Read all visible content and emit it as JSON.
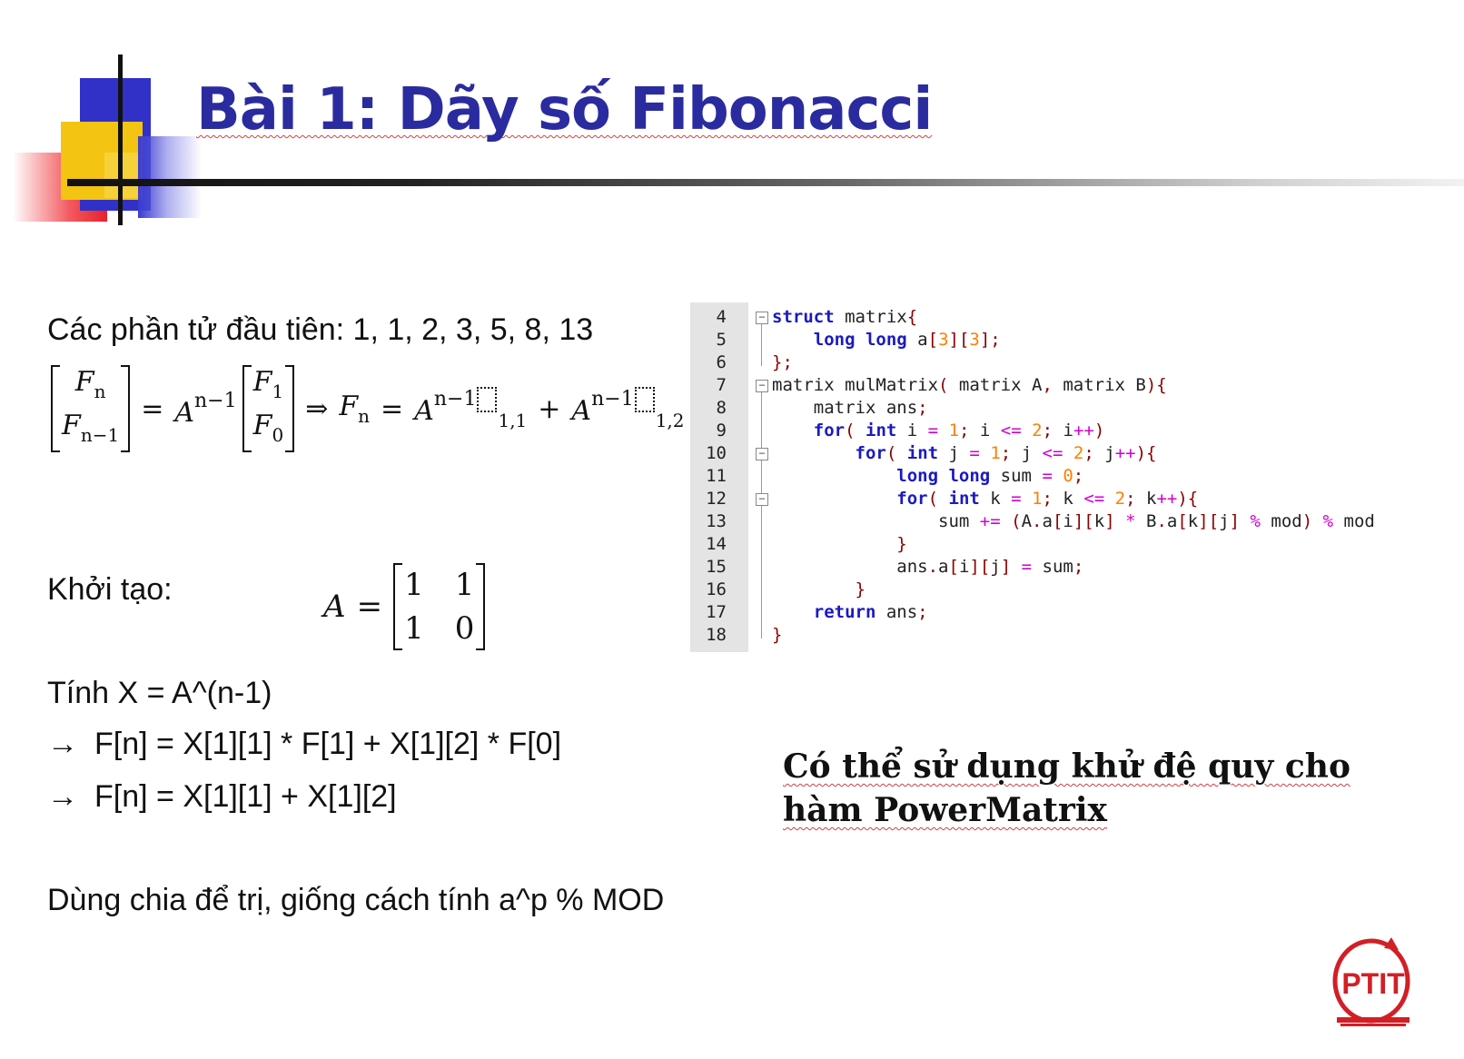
{
  "slide": {
    "title": "Bài 1: Dãy số Fibonacci",
    "elements_line": "Các phần tử đầu tiên: 1, 1, 2, 3, 5, 8, 13",
    "formula": {
      "lhs_top": "F",
      "lhs_top_sub": "n",
      "lhs_bottom": "F",
      "lhs_bottom_sub": "n−1",
      "eq": "=",
      "A": "A",
      "power": "n−1",
      "rhs_top": "F",
      "rhs_top_sub": "1",
      "rhs_bottom": "F",
      "rhs_bottom_sub": "0",
      "implies": "⇒",
      "Fn": "F",
      "Fn_sub": "n",
      "idx1": "1,1",
      "plus": "+",
      "idx2": "1,2"
    },
    "init_label": "Khởi tạo:",
    "matrix_A": {
      "name": "A",
      "eq": "=",
      "rows": [
        [
          "1",
          "1"
        ],
        [
          "1",
          "0"
        ]
      ]
    },
    "compute_line": "Tính X = A^(n-1)",
    "arrow_lines": [
      "F[n] = X[1][1] * F[1] + X[1][2] * F[0]",
      "F[n] = X[1][1] + X[1][2]"
    ],
    "arrow_icon": "right-arrow-icon",
    "dnc_line": "Dùng chia để trị, giống cách tính a^p % MOD",
    "note": "Có thể sử dụng khử đệ quy cho hàm PowerMatrix",
    "logo_text": "PTIT"
  },
  "code": {
    "line_numbers": [
      "4",
      "5",
      "6",
      "7",
      "8",
      "9",
      "10",
      "11",
      "12",
      "13",
      "14",
      "15",
      "16",
      "17",
      "18"
    ],
    "lines": [
      "struct matrix{",
      "    long long a[3][3];",
      "};",
      "matrix mulMatrix( matrix A, matrix B){",
      "    matrix ans;",
      "    for( int i = 1; i <= 2; i++)",
      "        for( int j = 1; j <= 2; j++){",
      "            long long sum = 0;",
      "            for( int k = 1; k <= 2; k++){",
      "                sum += (A.a[i][k] * B.a[k][j] % mod) % mod",
      "            }",
      "            ans.a[i][j] = sum;",
      "        }",
      "    return ans;",
      "}"
    ]
  },
  "colors": {
    "title": "#2b2ba0",
    "keyword": "#1a1ac0",
    "number": "#ff7f00",
    "logo_red": "#d21f26"
  }
}
